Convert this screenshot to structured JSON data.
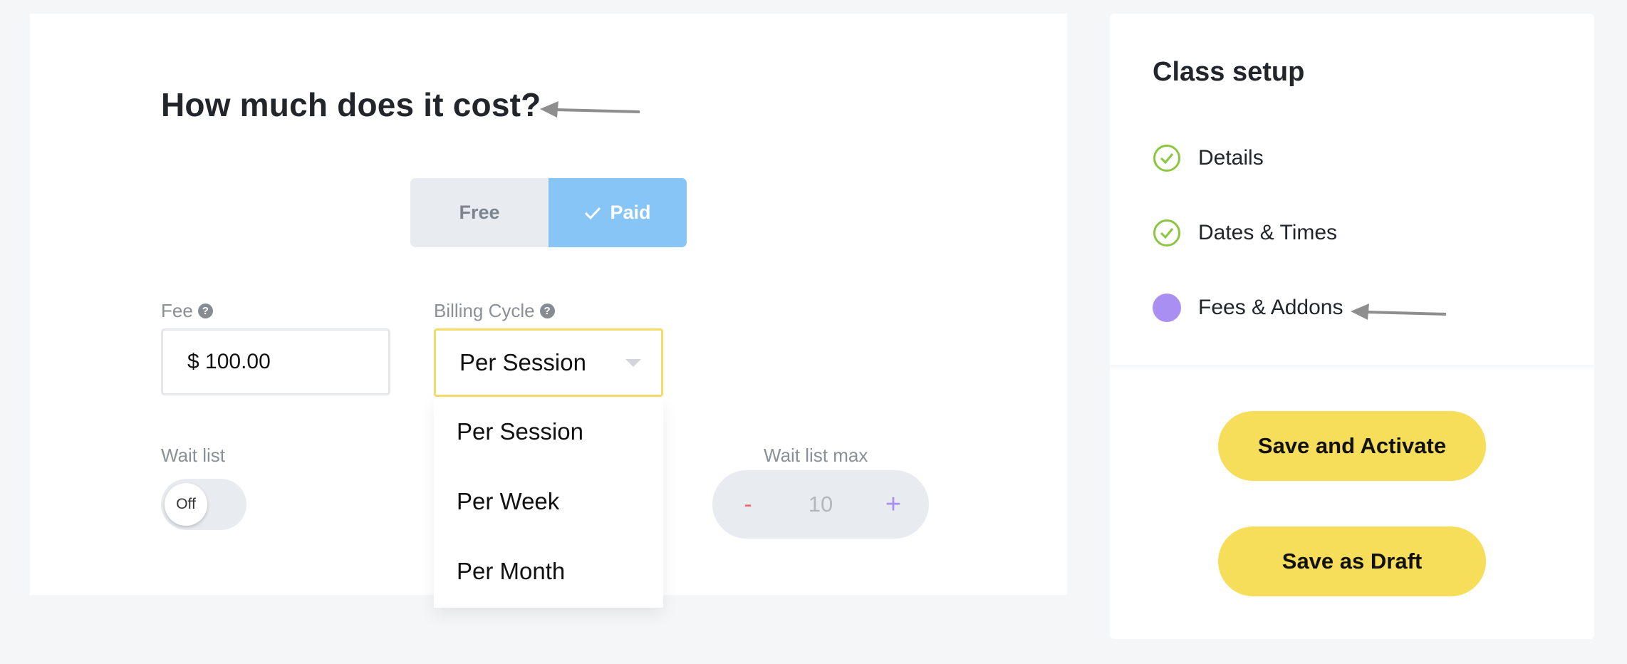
{
  "main": {
    "title": "How much does it cost?",
    "pricing_toggle": {
      "free_label": "Free",
      "paid_label": "Paid",
      "selected": "Paid"
    },
    "fee": {
      "label": "Fee",
      "help": "?",
      "value": "$ 100.00"
    },
    "billing_cycle": {
      "label": "Billing Cycle",
      "help": "?",
      "selected": "Per Session",
      "options": [
        "Per Session",
        "Per Week",
        "Per Month"
      ]
    },
    "wait_list": {
      "label": "Wait list",
      "toggle_text": "Off"
    },
    "wait_list_max": {
      "label": "Wait list max",
      "minus": "-",
      "value": "10",
      "plus": "+"
    }
  },
  "sidebar": {
    "title": "Class setup",
    "steps": [
      {
        "label": "Details",
        "status": "complete",
        "icon": "check-circle-icon"
      },
      {
        "label": "Dates & Times",
        "status": "complete",
        "icon": "check-circle-icon"
      },
      {
        "label": "Fees & Addons",
        "status": "current",
        "icon": "current-dot-icon"
      }
    ],
    "save_activate_label": "Save and Activate",
    "save_draft_label": "Save as Draft"
  },
  "colors": {
    "accent_yellow": "#f6dd5a",
    "paid_blue": "#86c5f5",
    "check_green": "#8cc540",
    "current_purple": "#a98ff2",
    "select_border": "#f6dc66"
  }
}
